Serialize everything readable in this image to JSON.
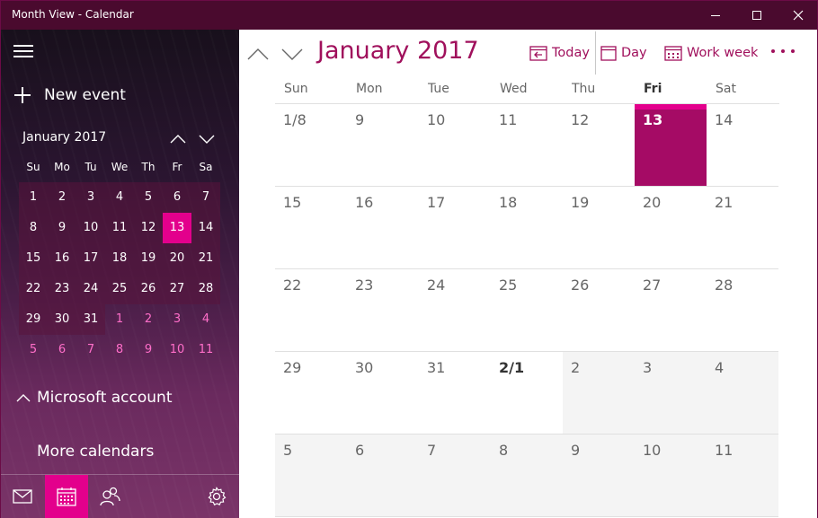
{
  "window": {
    "title": "Month View - Calendar"
  },
  "sidebar": {
    "new_event": "New event",
    "mini_calendar": {
      "title": "January 2017",
      "weekdays": [
        "Su",
        "Mo",
        "Tu",
        "We",
        "Th",
        "Fr",
        "Sa"
      ],
      "days": [
        {
          "n": "1",
          "t": "cur"
        },
        {
          "n": "2",
          "t": "cur"
        },
        {
          "n": "3",
          "t": "cur"
        },
        {
          "n": "4",
          "t": "cur"
        },
        {
          "n": "5",
          "t": "cur"
        },
        {
          "n": "6",
          "t": "cur"
        },
        {
          "n": "7",
          "t": "cur"
        },
        {
          "n": "8",
          "t": "cur"
        },
        {
          "n": "9",
          "t": "cur"
        },
        {
          "n": "10",
          "t": "cur"
        },
        {
          "n": "11",
          "t": "cur"
        },
        {
          "n": "12",
          "t": "cur"
        },
        {
          "n": "13",
          "t": "today"
        },
        {
          "n": "14",
          "t": "cur"
        },
        {
          "n": "15",
          "t": "cur"
        },
        {
          "n": "16",
          "t": "cur"
        },
        {
          "n": "17",
          "t": "cur"
        },
        {
          "n": "18",
          "t": "cur"
        },
        {
          "n": "19",
          "t": "cur"
        },
        {
          "n": "20",
          "t": "cur"
        },
        {
          "n": "21",
          "t": "cur"
        },
        {
          "n": "22",
          "t": "cur"
        },
        {
          "n": "23",
          "t": "cur"
        },
        {
          "n": "24",
          "t": "cur"
        },
        {
          "n": "25",
          "t": "cur"
        },
        {
          "n": "26",
          "t": "cur"
        },
        {
          "n": "27",
          "t": "cur"
        },
        {
          "n": "28",
          "t": "cur"
        },
        {
          "n": "29",
          "t": "cur"
        },
        {
          "n": "30",
          "t": "cur"
        },
        {
          "n": "31",
          "t": "cur"
        },
        {
          "n": "1",
          "t": "other"
        },
        {
          "n": "2",
          "t": "other"
        },
        {
          "n": "3",
          "t": "other"
        },
        {
          "n": "4",
          "t": "other"
        },
        {
          "n": "5",
          "t": "other"
        },
        {
          "n": "6",
          "t": "other"
        },
        {
          "n": "7",
          "t": "other"
        },
        {
          "n": "8",
          "t": "other"
        },
        {
          "n": "9",
          "t": "other"
        },
        {
          "n": "10",
          "t": "other"
        },
        {
          "n": "11",
          "t": "other"
        }
      ]
    },
    "microsoft_account": "Microsoft account",
    "more_calendars": "More calendars",
    "bottom_icons": [
      "mail-icon",
      "calendar-icon",
      "people-icon",
      "settings-icon"
    ]
  },
  "toolbar": {
    "month_title": "January 2017",
    "today": "Today",
    "day": "Day",
    "work_week": "Work week"
  },
  "month_view": {
    "weekdays": [
      "Sun",
      "Mon",
      "Tue",
      "Wed",
      "Thu",
      "Fri",
      "Sat"
    ],
    "today_weekday_index": 5,
    "cells": [
      {
        "n": "1/8",
        "t": "cur"
      },
      {
        "n": "9",
        "t": "cur"
      },
      {
        "n": "10",
        "t": "cur"
      },
      {
        "n": "11",
        "t": "cur"
      },
      {
        "n": "12",
        "t": "cur"
      },
      {
        "n": "13",
        "t": "today"
      },
      {
        "n": "14",
        "t": "cur"
      },
      {
        "n": "15",
        "t": "cur"
      },
      {
        "n": "16",
        "t": "cur"
      },
      {
        "n": "17",
        "t": "cur"
      },
      {
        "n": "18",
        "t": "cur"
      },
      {
        "n": "19",
        "t": "cur"
      },
      {
        "n": "20",
        "t": "cur"
      },
      {
        "n": "21",
        "t": "cur"
      },
      {
        "n": "22",
        "t": "cur"
      },
      {
        "n": "23",
        "t": "cur"
      },
      {
        "n": "24",
        "t": "cur"
      },
      {
        "n": "25",
        "t": "cur"
      },
      {
        "n": "26",
        "t": "cur"
      },
      {
        "n": "27",
        "t": "cur"
      },
      {
        "n": "28",
        "t": "cur"
      },
      {
        "n": "29",
        "t": "cur"
      },
      {
        "n": "30",
        "t": "cur"
      },
      {
        "n": "31",
        "t": "cur"
      },
      {
        "n": "2/1",
        "t": "first"
      },
      {
        "n": "2",
        "t": "next"
      },
      {
        "n": "3",
        "t": "next"
      },
      {
        "n": "4",
        "t": "next"
      },
      {
        "n": "5",
        "t": "next"
      },
      {
        "n": "6",
        "t": "next"
      },
      {
        "n": "7",
        "t": "next"
      },
      {
        "n": "8",
        "t": "next"
      },
      {
        "n": "9",
        "t": "next"
      },
      {
        "n": "10",
        "t": "next"
      },
      {
        "n": "11",
        "t": "next"
      }
    ]
  },
  "colors": {
    "accent": "#e3008c",
    "accent_dark": "#a50b65",
    "title_bar": "#4a0a2e",
    "title_text": "#a0105c"
  }
}
